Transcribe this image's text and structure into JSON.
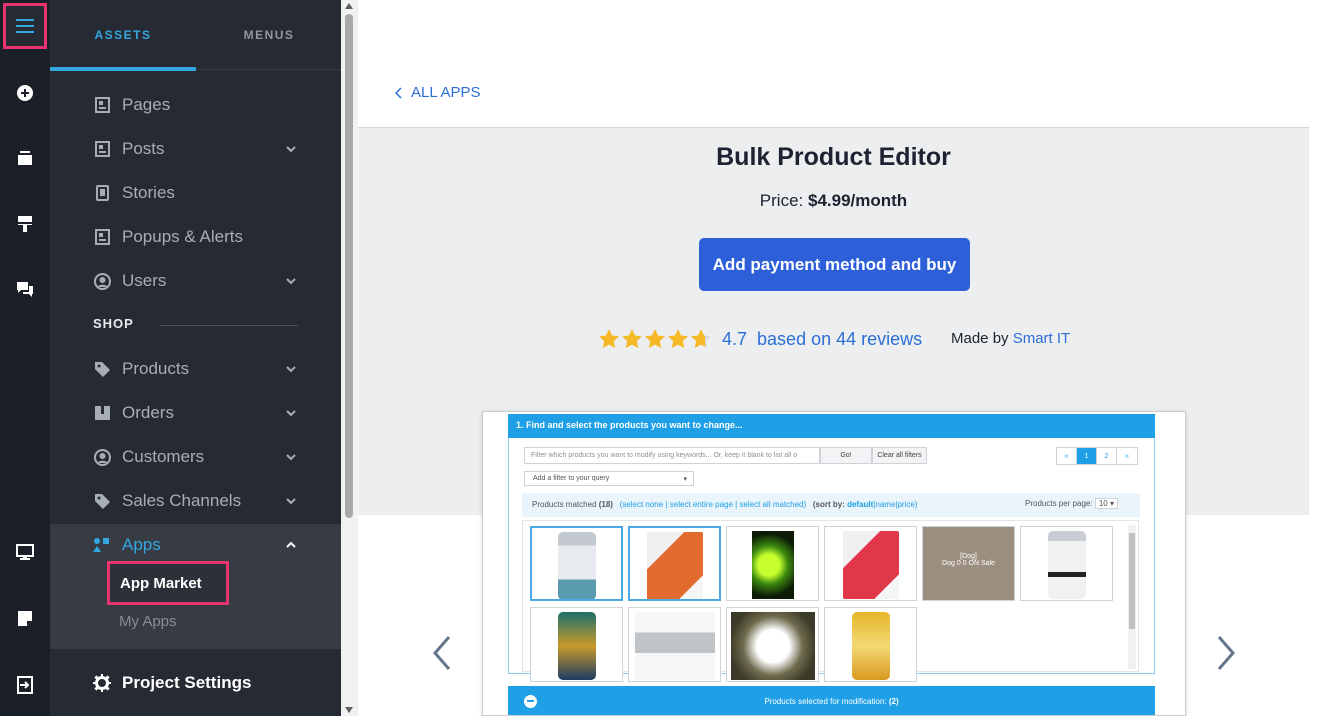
{
  "sidebar": {
    "tabs": [
      {
        "label": "ASSETS",
        "active": true
      },
      {
        "label": "MENUS",
        "active": false
      }
    ],
    "items": [
      {
        "label": "Pages",
        "icon": "page-icon"
      },
      {
        "label": "Posts",
        "icon": "page-icon",
        "expandable": true
      },
      {
        "label": "Stories",
        "icon": "stories-icon"
      },
      {
        "label": "Popups & Alerts",
        "icon": "page-icon"
      },
      {
        "label": "Users",
        "icon": "user-circle-icon",
        "expandable": true
      }
    ],
    "shop_section": "SHOP",
    "shop_items": [
      {
        "label": "Products",
        "icon": "tag-icon",
        "expandable": true
      },
      {
        "label": "Orders",
        "icon": "box-icon",
        "expandable": true
      },
      {
        "label": "Customers",
        "icon": "user-circle-icon",
        "expandable": true
      },
      {
        "label": "Sales Channels",
        "icon": "tag-icon",
        "expandable": true
      }
    ],
    "apps": {
      "label": "Apps",
      "icon": "apps-icon",
      "expanded": true,
      "sub_items": [
        {
          "label": "App Market",
          "active": true
        },
        {
          "label": "My Apps",
          "active": false
        }
      ]
    },
    "project_settings": "Project Settings"
  },
  "rail": {
    "icons": [
      "menu-icon",
      "add-circle-icon",
      "layers-icon",
      "brush-icon",
      "chat-icon",
      "monitor-icon",
      "note-icon",
      "exit-icon"
    ]
  },
  "main": {
    "back_link": "ALL APPS",
    "app_title": "Bulk Product Editor",
    "price_label": "Price:",
    "price_value": "$4.99/month",
    "buy_button": "Add payment method and buy",
    "rating": {
      "stars_value": 4.7,
      "value_text": "4.7",
      "reviews_text": "based on 44 reviews"
    },
    "made_by_label": "Made by",
    "made_by_author": "Smart IT",
    "screenshot": {
      "header": "1. Find and select the products you want to change...",
      "filter_placeholder": "Filter which products you want to modify using keywords... Or, keep it blank to list all o",
      "go_button": "Go!",
      "clear_button": "Clear all filters",
      "pager": [
        "«",
        "1",
        "2",
        "»"
      ],
      "current_page": "1",
      "add_filter": "Add a filter to your query",
      "matched_prefix": "Products matched",
      "matched_count": "(18)",
      "select_none": "(select none",
      "select_page": "select entire page",
      "select_all": "select all matched)",
      "sort_label": "(sort by:",
      "sort_default": "default",
      "sort_name": "name",
      "sort_price": "price)",
      "per_page_label": "Products per page:",
      "per_page_value": "10",
      "thumb_sale_title": "[Dog]",
      "thumb_sale_subtitle": "Dog 0 0 ON Sale",
      "footer_label": "Products selected for modification:",
      "footer_count": "(2)"
    }
  },
  "colors": {
    "accent": "#34a7e0",
    "primary_button": "#2c5fd8",
    "highlight": "#e8336d",
    "star": "#f6b928",
    "link": "#2b6fd6"
  }
}
